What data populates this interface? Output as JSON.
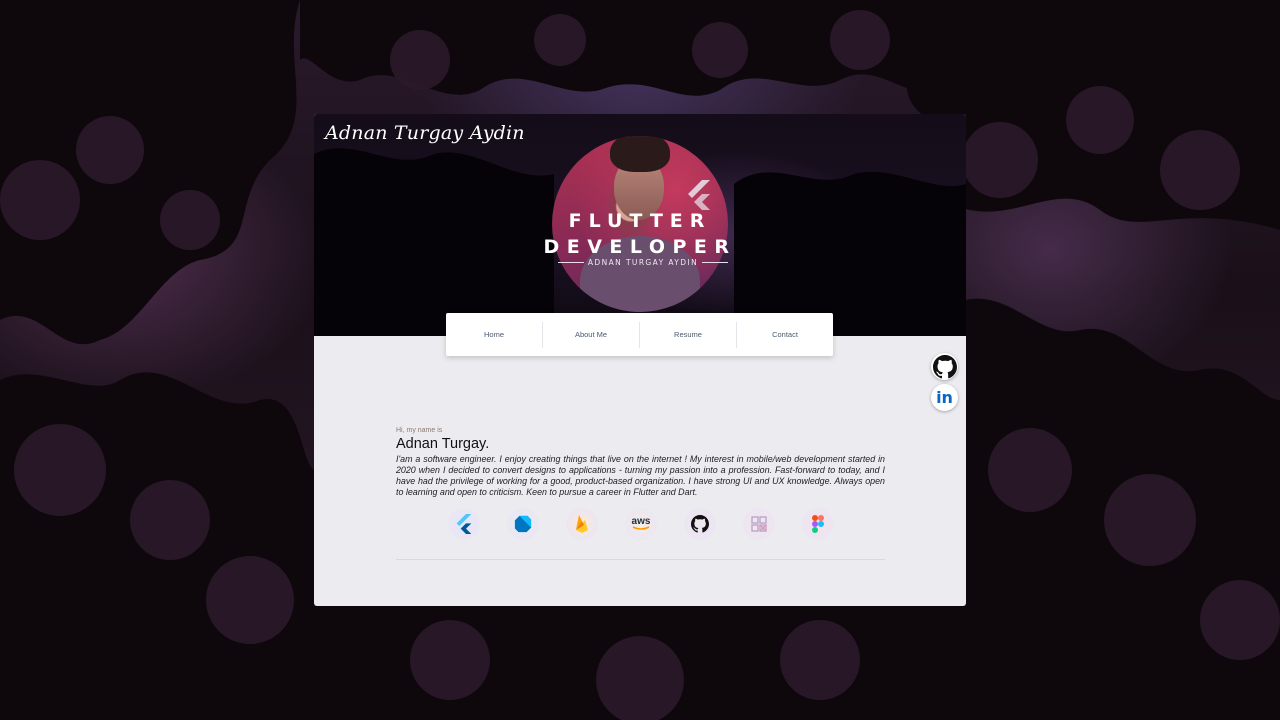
{
  "brand": {
    "name": "Adnan Turgay Aydin"
  },
  "hero": {
    "title_line1": "FLUTTER",
    "title_line2": "DEVELOPER",
    "subtitle": "ADNAN TURGAY AYDIN"
  },
  "nav": {
    "items": [
      {
        "label": "Home"
      },
      {
        "label": "About Me"
      },
      {
        "label": "Resume"
      },
      {
        "label": "Contact"
      }
    ]
  },
  "intro": {
    "greeting": "Hi, my name is",
    "name": "Adnan Turgay.",
    "bio": "I'am a software engineer. I enjoy creating things that live on the internet ! My interest in mobile/web development started in 2020 when I decided to convert designs to applications - turning my passion into a profession. Fast-forward to today, and I have had the privilege of working for a good, product-based organization. I have strong UI and UX knowledge. Always open to learning and open to criticism. Keen to pursue a career in Flutter and Dart."
  },
  "skills": [
    {
      "icon": "flutter-icon"
    },
    {
      "icon": "dart-icon"
    },
    {
      "icon": "firebase-icon"
    },
    {
      "icon": "aws-icon",
      "label": "aws"
    },
    {
      "icon": "github-icon"
    },
    {
      "icon": "hive-icon"
    },
    {
      "icon": "figma-icon"
    }
  ],
  "social": [
    {
      "icon": "github-icon"
    },
    {
      "icon": "linkedin-icon",
      "label": "in"
    }
  ],
  "colors": {
    "accent": "#0a66c2",
    "nav_text": "#4a5a70",
    "card_bg": "#ececf0"
  }
}
